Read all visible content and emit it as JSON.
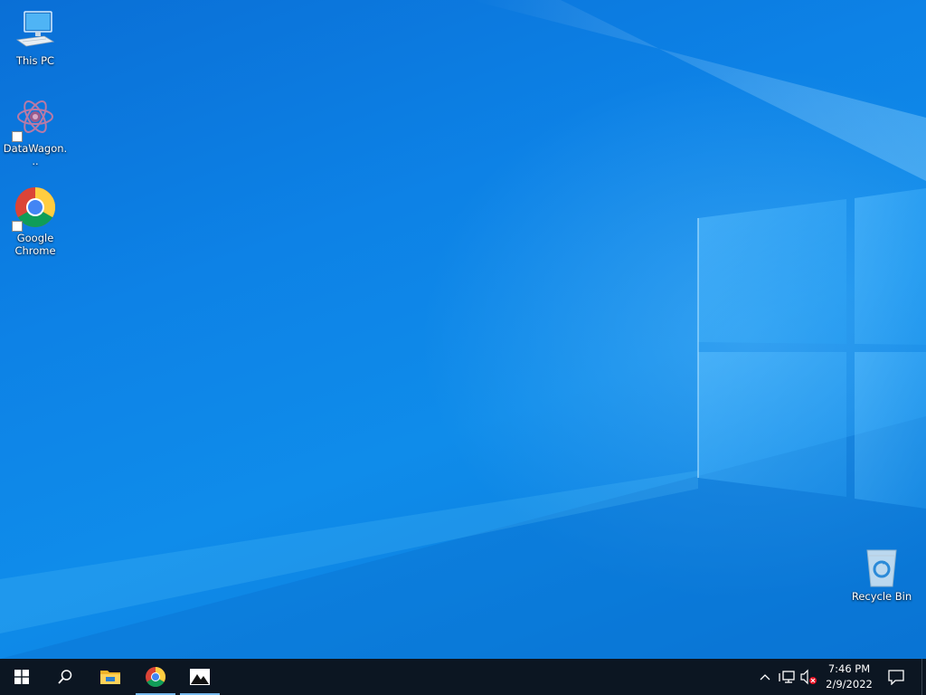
{
  "desktop": {
    "icons": [
      {
        "label": "This PC",
        "icon": "this-pc-icon"
      },
      {
        "label": "DataWagon...",
        "icon": "datawagon-icon"
      },
      {
        "label": "Google Chrome",
        "icon": "chrome-icon"
      },
      {
        "label": "Recycle Bin",
        "icon": "recycle-bin-icon"
      }
    ]
  },
  "taskbar": {
    "buttons": [
      {
        "icon": "windows-start-icon"
      },
      {
        "icon": "search-icon"
      },
      {
        "icon": "file-explorer-icon"
      },
      {
        "icon": "chrome-icon",
        "active": true
      },
      {
        "icon": "photos-icon",
        "active": true
      }
    ],
    "tray": {
      "icons": [
        "chevron-up-icon",
        "network-icon",
        "volume-muted-icon"
      ],
      "time": "7:46 PM",
      "date": "2/9/2022"
    }
  },
  "colors": {
    "wallpaper": "#0d82e6",
    "taskbar": "#0c1622",
    "active_indicator": "#76b9ed"
  }
}
